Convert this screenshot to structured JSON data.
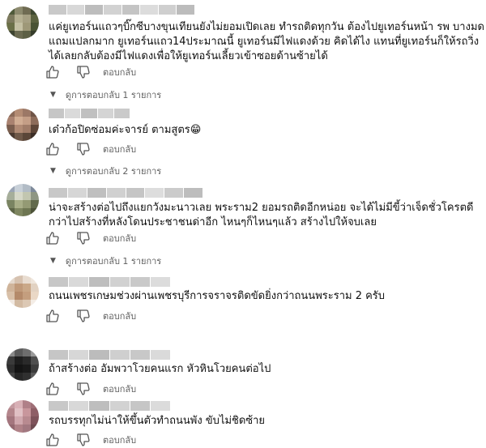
{
  "icons": {
    "like": "thumb-up-icon",
    "dislike": "thumb-down-icon",
    "expand": "caret-down-icon"
  },
  "comments": [
    {
      "lines": [
        "แค่ยูเทอร์นแถวๆบิ๊กซีบางขุนเทียนยังไม่ยอมเปิดเลย ทำรถติดทุกวัน ต้องไปยูเทอร์นหน้า รพ บางมด",
        "แถมแปลกมาก ยูเทอร์นแถว14ประมาณนี้ ยูเทอร์นมีไฟแดงด้วย คิดได้ไง แทนที่ยูเทอร์นก็ให้รถวิ่ง",
        "ได้เลยกลับต้องมีไฟแดงเพื่อให้ยูเทอร์นเลี้ยวเข้าซอยด้านซ้ายได้"
      ],
      "reply_label": "ตอบกลับ",
      "replies_label": "ดูการตอบกลับ 1 รายการ"
    },
    {
      "lines": [
        "เด๋วก้อปิดซ่อมค่ะจารย์ ตามสูตร😁"
      ],
      "reply_label": "ตอบกลับ",
      "replies_label": "ดูการตอบกลับ 2 รายการ"
    },
    {
      "lines": [
        "น่าจะสร้างต่อไปถึงแยกวังมะนาวเลย พระราม2 ยอมรถติดอีกหน่อย จะได้ไม่มีขี้ว่าเจ็ดชั่วโครตดี",
        "กว่าไปสร้างที่หลังโดนประชาชนด่าอีก ไหนๆก็ไหนๆแล้ว สร้างไปให้จบเลย"
      ],
      "reply_label": "ตอบกลับ",
      "replies_label": "ดูการตอบกลับ 1 รายการ"
    },
    {
      "lines": [
        "ถนนเพชรเกษมช่วงผ่านเพชรบุรีการจราจรติดขัดยิ่งกว่าถนนพระราม 2 ครับ"
      ],
      "reply_label": "ตอบกลับ"
    },
    {
      "lines": [
        "ถ้าสร้างต่อ อัมพวาโวยคนแรก หัวหินโวยคนต่อไป"
      ],
      "reply_label": "ตอบกลับ"
    },
    {
      "lines": [
        "รถบรรทุกไม่น่าให้ขึ้นตัวทำถนนพัง ขับไม่ชิดซ้าย"
      ],
      "reply_label": "ตอบกลับ"
    }
  ]
}
